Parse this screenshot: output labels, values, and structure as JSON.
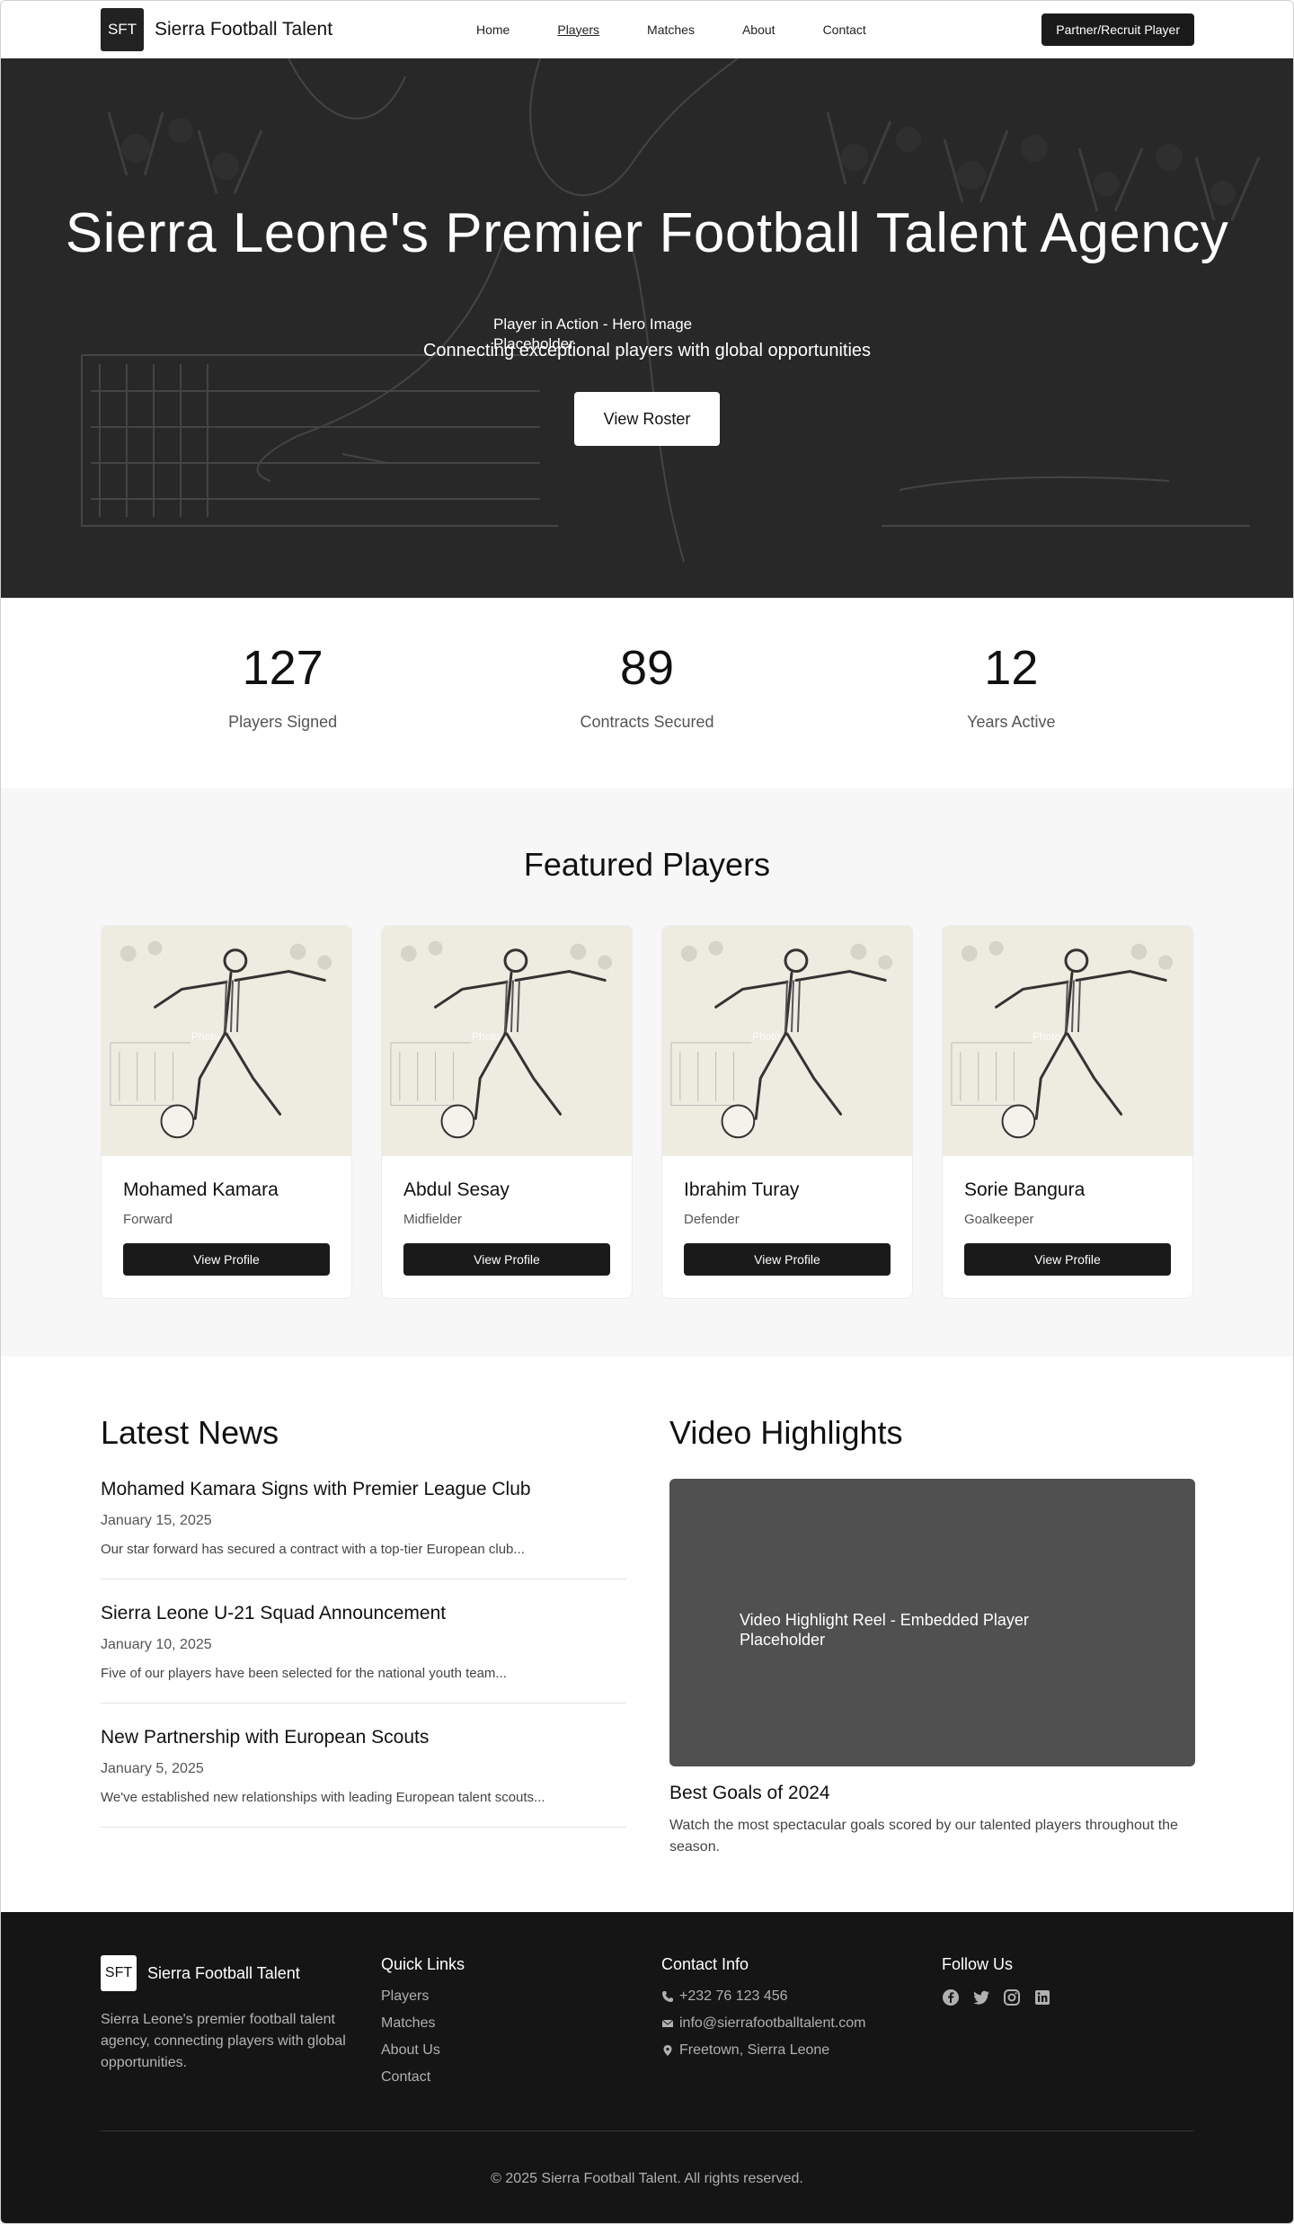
{
  "nav": {
    "logo": "SFT",
    "brand": "Sierra Football Talent",
    "links": [
      "Home",
      "Players",
      "Matches",
      "About",
      "Contact"
    ],
    "active": "Players",
    "cta": "Partner/Recruit Player"
  },
  "hero": {
    "title": "Sierra Leone's Premier Football Talent Agency",
    "image_placeholder": "Player in Action - Hero Image Placeholder",
    "subtitle": "Connecting exceptional players with global opportunities",
    "button": "View Roster"
  },
  "stats": [
    {
      "value": "127",
      "label": "Players Signed"
    },
    {
      "value": "89",
      "label": "Contracts Secured"
    },
    {
      "value": "12",
      "label": "Years Active"
    }
  ],
  "featured": {
    "title": "Featured Players",
    "image_caption": "Photo",
    "button_label": "View Profile",
    "players": [
      {
        "name": "Mohamed Kamara",
        "position": "Forward"
      },
      {
        "name": "Abdul Sesay",
        "position": "Midfielder"
      },
      {
        "name": "Ibrahim Turay",
        "position": "Defender"
      },
      {
        "name": "Sorie Bangura",
        "position": "Goalkeeper"
      }
    ]
  },
  "news": {
    "title": "Latest News",
    "items": [
      {
        "title": "Mohamed Kamara Signs with Premier League Club",
        "date": "January 15, 2025",
        "excerpt": "Our star forward has secured a contract with a top-tier European club..."
      },
      {
        "title": "Sierra Leone U-21 Squad Announcement",
        "date": "January 10, 2025",
        "excerpt": "Five of our players have been selected for the national youth team..."
      },
      {
        "title": "New Partnership with European Scouts",
        "date": "January 5, 2025",
        "excerpt": "We've established new relationships with leading European talent scouts..."
      }
    ]
  },
  "video": {
    "title": "Video Highlights",
    "placeholder": "Video Highlight Reel - Embedded Player Placeholder",
    "clip_title": "Best Goals of 2024",
    "clip_desc": "Watch the most spectacular goals scored by our talented players throughout the season."
  },
  "footer": {
    "logo": "SFT",
    "brand": "Sierra Football Talent",
    "desc": "Sierra Leone's premier football talent agency, connecting players with global opportunities.",
    "quick_links_title": "Quick Links",
    "quick_links": [
      "Players",
      "Matches",
      "About Us",
      "Contact"
    ],
    "contact_title": "Contact Info",
    "phone": "+232 76 123 456",
    "email": "info@sierrafootballtalent.com",
    "address": "Freetown, Sierra Leone",
    "follow_title": "Follow Us",
    "social": [
      "facebook-icon",
      "twitter-icon",
      "instagram-icon",
      "linkedin-icon"
    ],
    "copyright": "© 2025 Sierra Football Talent. All rights reserved."
  }
}
